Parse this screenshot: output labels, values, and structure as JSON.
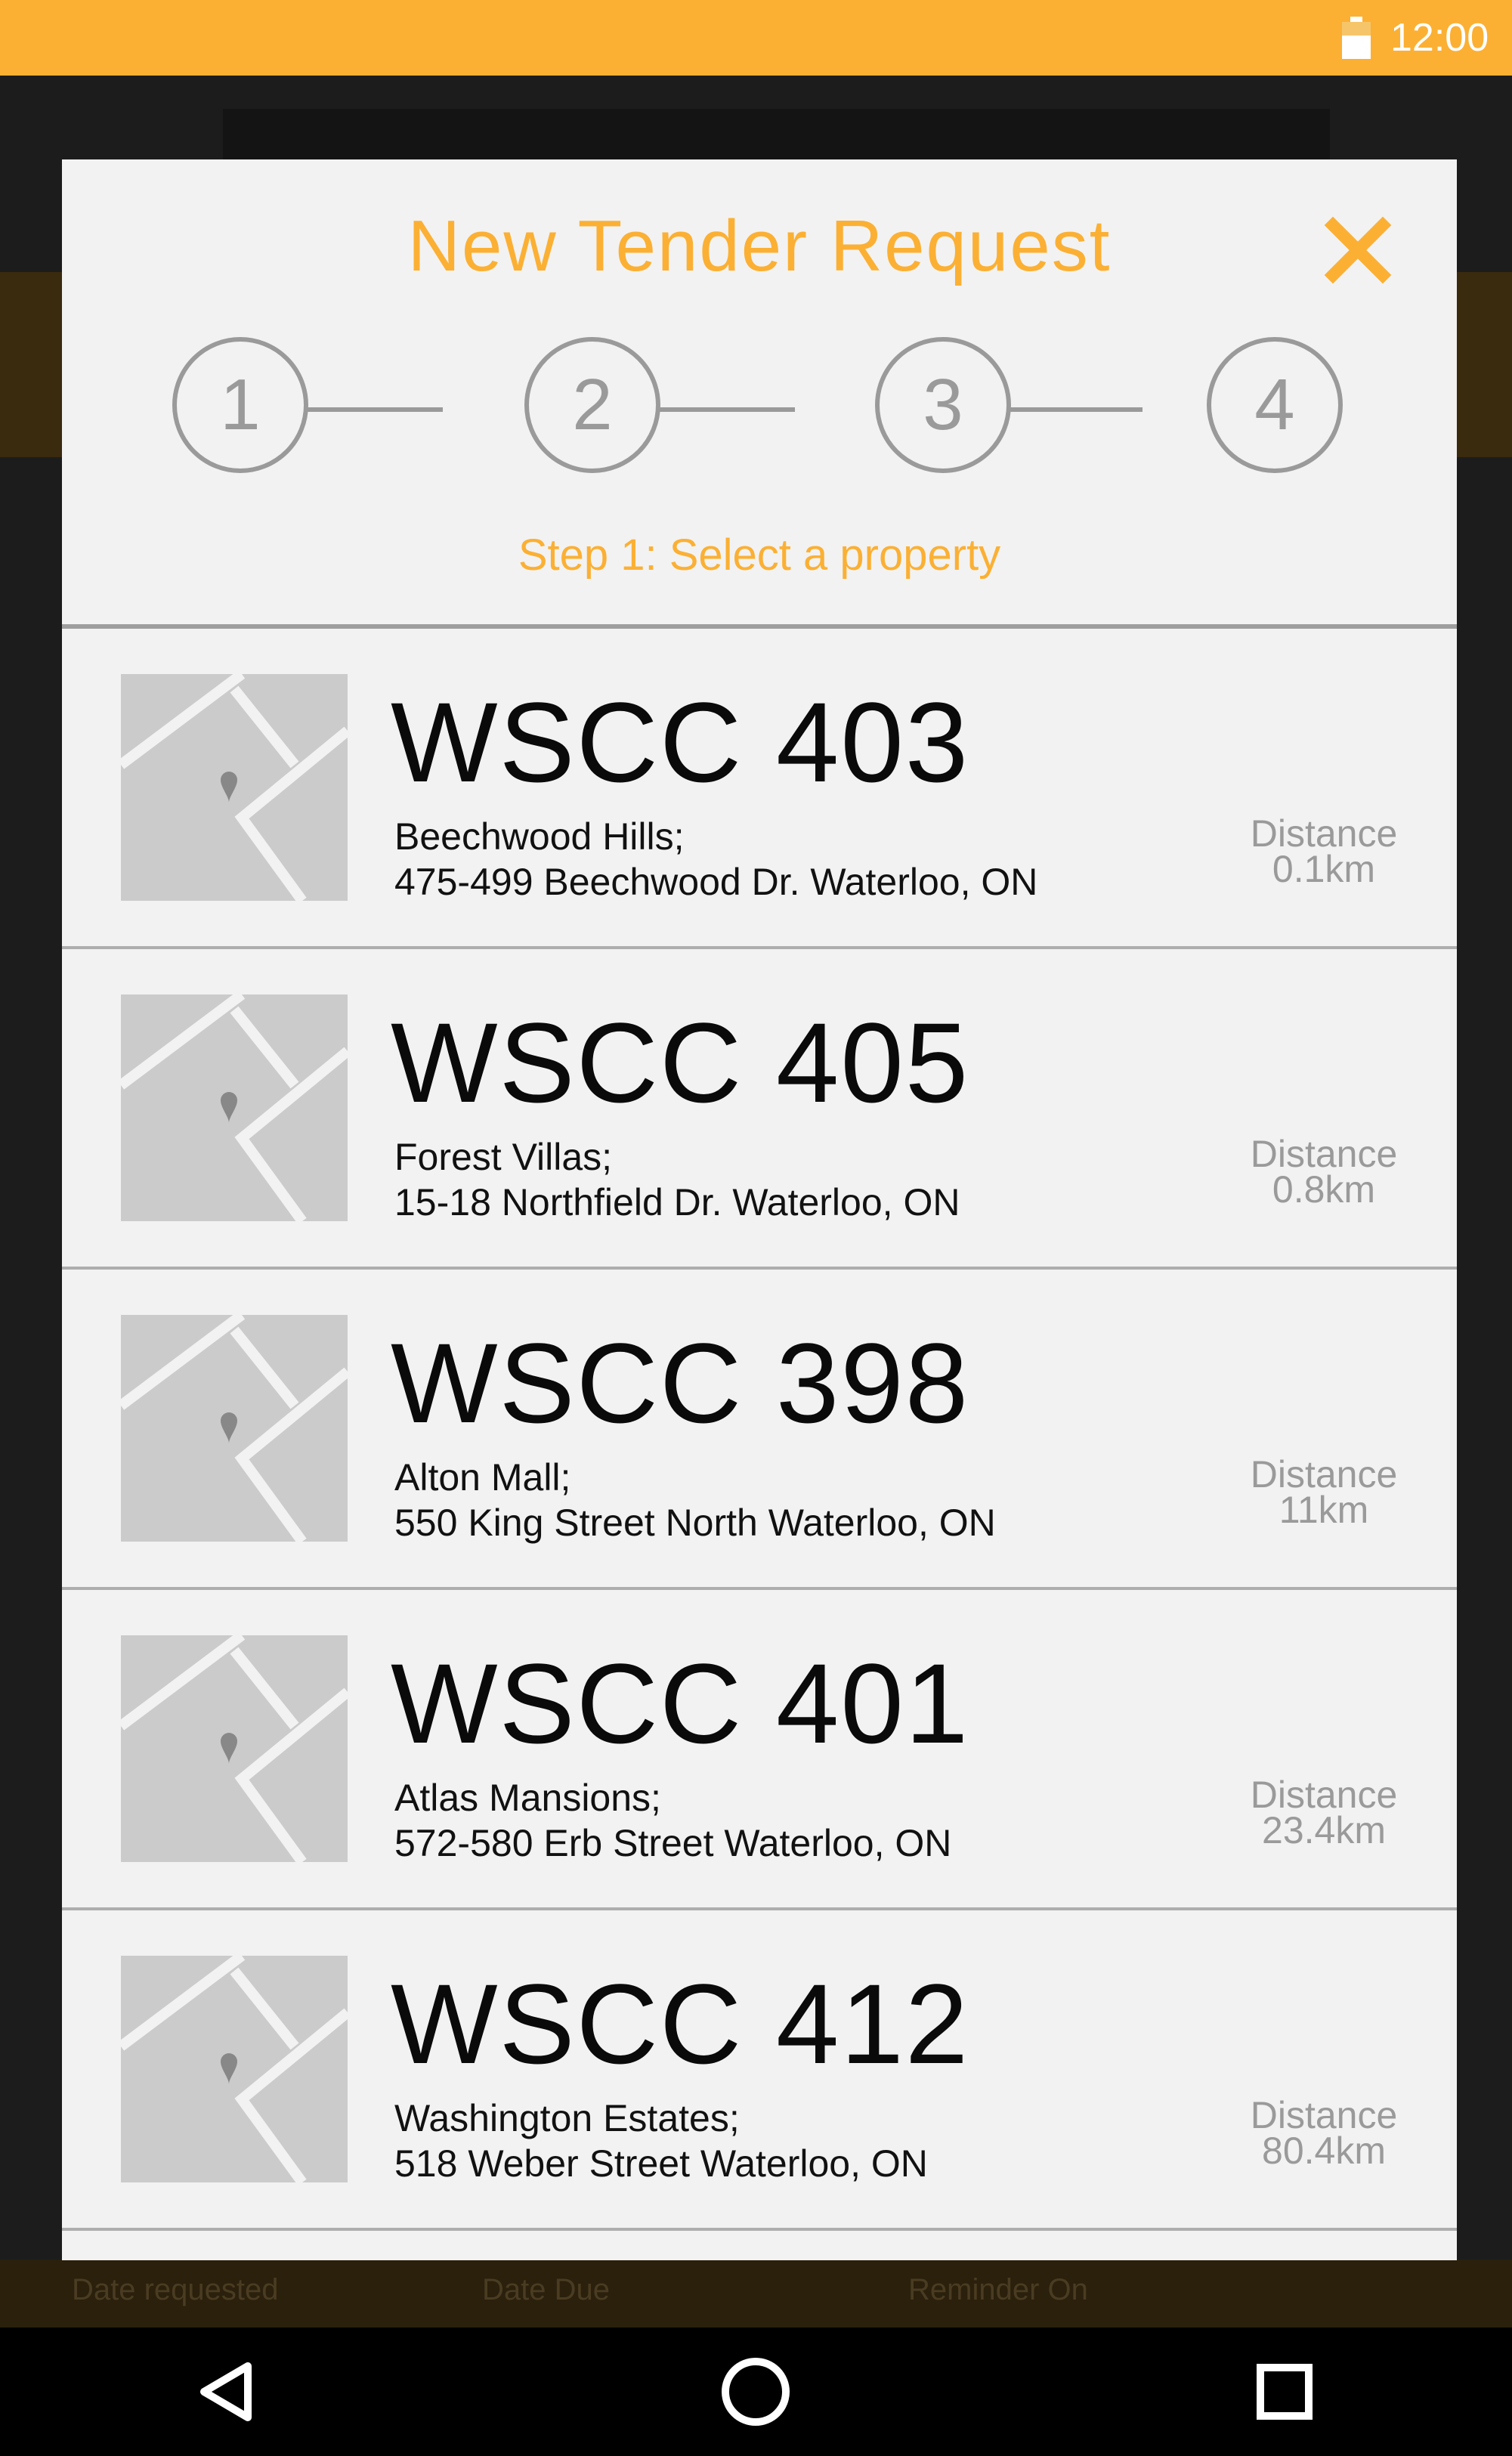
{
  "status_bar": {
    "time": "12:00",
    "icons": [
      "battery-icon"
    ],
    "background_color": "#fbb034"
  },
  "background": {
    "footer_labels": [
      "Date requested",
      "Date Due",
      "Reminder On"
    ]
  },
  "dialog": {
    "title": "New Tender Request",
    "close_icon": "close-icon",
    "accent_color": "#fbb034",
    "steps": [
      {
        "label": "1",
        "active": true
      },
      {
        "label": "2",
        "active": false
      },
      {
        "label": "3",
        "active": false
      },
      {
        "label": "4",
        "active": false
      }
    ],
    "step_caption": "Step 1: Select a property",
    "properties": [
      {
        "name": "WSCC 403",
        "subtitle": "Beechwood Hills;",
        "address": "475-499 Beechwood Dr. Waterloo, ON",
        "distance_label": "Distance",
        "distance": "0.1km"
      },
      {
        "name": "WSCC 405",
        "subtitle": "Forest Villas;",
        "address": "15-18 Northfield Dr. Waterloo, ON",
        "distance_label": "Distance",
        "distance": "0.8km"
      },
      {
        "name": "WSCC 398",
        "subtitle": "Alton Mall;",
        "address": "550 King Street North Waterloo, ON",
        "distance_label": "Distance",
        "distance": "11km"
      },
      {
        "name": "WSCC 401",
        "subtitle": "Atlas Mansions;",
        "address": "572-580 Erb Street Waterloo, ON",
        "distance_label": "Distance",
        "distance": "23.4km"
      },
      {
        "name": "WSCC 412",
        "subtitle": "Washington Estates;",
        "address": "518 Weber Street Waterloo, ON",
        "distance_label": "Distance",
        "distance": "80.4km"
      }
    ]
  },
  "nav_bar": {
    "icons": [
      "back-icon",
      "home-icon",
      "recents-icon"
    ]
  }
}
